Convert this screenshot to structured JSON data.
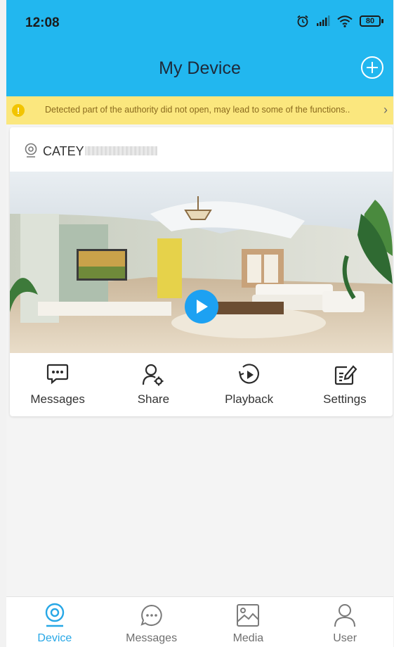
{
  "status_bar": {
    "time": "12:08",
    "battery": "80"
  },
  "header": {
    "title": "My Device"
  },
  "warning": {
    "text": "Detected part of the authority did not open, may lead to some of the functions.."
  },
  "device": {
    "name": "CATEY"
  },
  "actions": [
    {
      "label": "Messages",
      "icon": "chat-bubble-icon"
    },
    {
      "label": "Share",
      "icon": "user-gear-icon"
    },
    {
      "label": "Playback",
      "icon": "playback-icon"
    },
    {
      "label": "Settings",
      "icon": "edit-settings-icon"
    }
  ],
  "nav": [
    {
      "label": "Device",
      "icon": "camera-icon",
      "active": true
    },
    {
      "label": "Messages",
      "icon": "chat-bubble-icon"
    },
    {
      "label": "Media",
      "icon": "image-icon"
    },
    {
      "label": "User",
      "icon": "user-icon"
    }
  ],
  "colors": {
    "accent": "#22b7ef",
    "warning_bg": "#fbe77e",
    "play": "#1da1f2",
    "active_nav": "#27a7e6"
  }
}
